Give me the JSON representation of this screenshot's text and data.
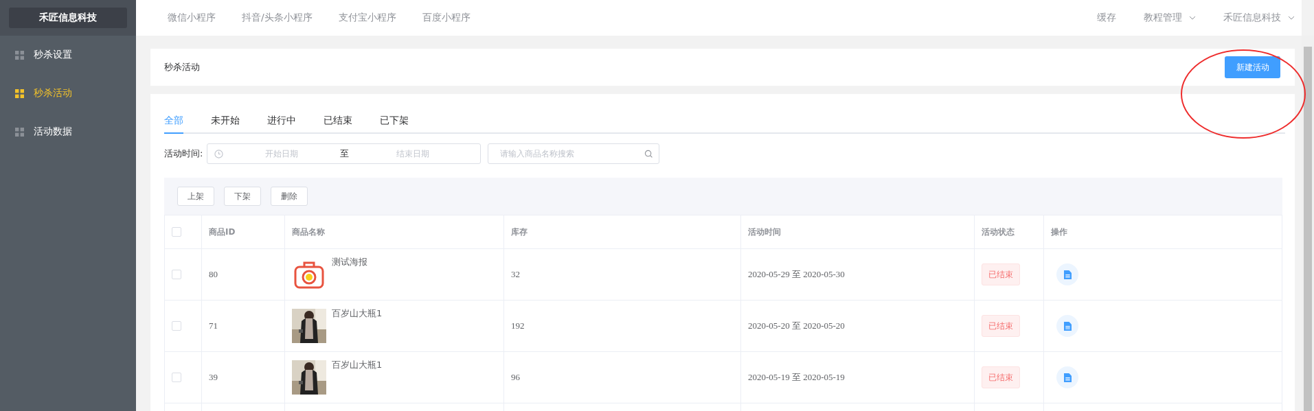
{
  "sidebar": {
    "brand": "禾匠信息科技",
    "items": [
      {
        "label": "秒杀设置",
        "selected": false
      },
      {
        "label": "秒杀活动",
        "selected": true
      },
      {
        "label": "活动数据",
        "selected": false
      }
    ]
  },
  "top_nav": {
    "left": [
      "微信小程序",
      "抖音/头条小程序",
      "支付宝小程序",
      "百度小程序"
    ],
    "right": [
      {
        "label": "缓存",
        "has_menu": false
      },
      {
        "label": "教程管理",
        "has_menu": true
      },
      {
        "label": "禾匠信息科技",
        "has_menu": true
      }
    ]
  },
  "header": {
    "title": "秒杀活动",
    "button": "新建活动",
    "annotation": {
      "kind": "ellipse"
    }
  },
  "tabs": [
    {
      "label": "全部",
      "selected": true
    },
    {
      "label": "未开始",
      "selected": false
    },
    {
      "label": "进行中",
      "selected": false
    },
    {
      "label": "已结束",
      "selected": false
    },
    {
      "label": "已下架",
      "selected": false
    }
  ],
  "filter": {
    "label": "活动时间:",
    "start_placeholder": "开始日期",
    "separator": "至",
    "end_placeholder": "结束日期",
    "search_placeholder": "请输入商品名称搜索"
  },
  "bulk_buttons": [
    "上架",
    "下架",
    "删除"
  ],
  "table": {
    "all_checked": false,
    "columns": [
      "商品ID",
      "商品名称",
      "库存",
      "活动时间",
      "活动状态",
      "操作"
    ],
    "rows": [
      {
        "checked": false,
        "id": "80",
        "name": "测试海报",
        "thumbnail": {
          "kind": "icon"
        },
        "stock": "32",
        "time": "2020-05-29 至 2020-05-30",
        "status": {
          "kind": "ended",
          "label": "已结束"
        }
      },
      {
        "checked": false,
        "id": "71",
        "name": "百岁山大瓶1",
        "stock": "192",
        "time": "2020-05-20 至 2020-05-20",
        "status": {
          "kind": "ended",
          "label": "已结束"
        }
      },
      {
        "checked": false,
        "id": "39",
        "name": "百岁山大瓶1",
        "stock": "96",
        "time": "2020-05-19 至 2020-05-19",
        "status": {
          "kind": "ended",
          "label": "已结束"
        }
      }
    ]
  }
}
